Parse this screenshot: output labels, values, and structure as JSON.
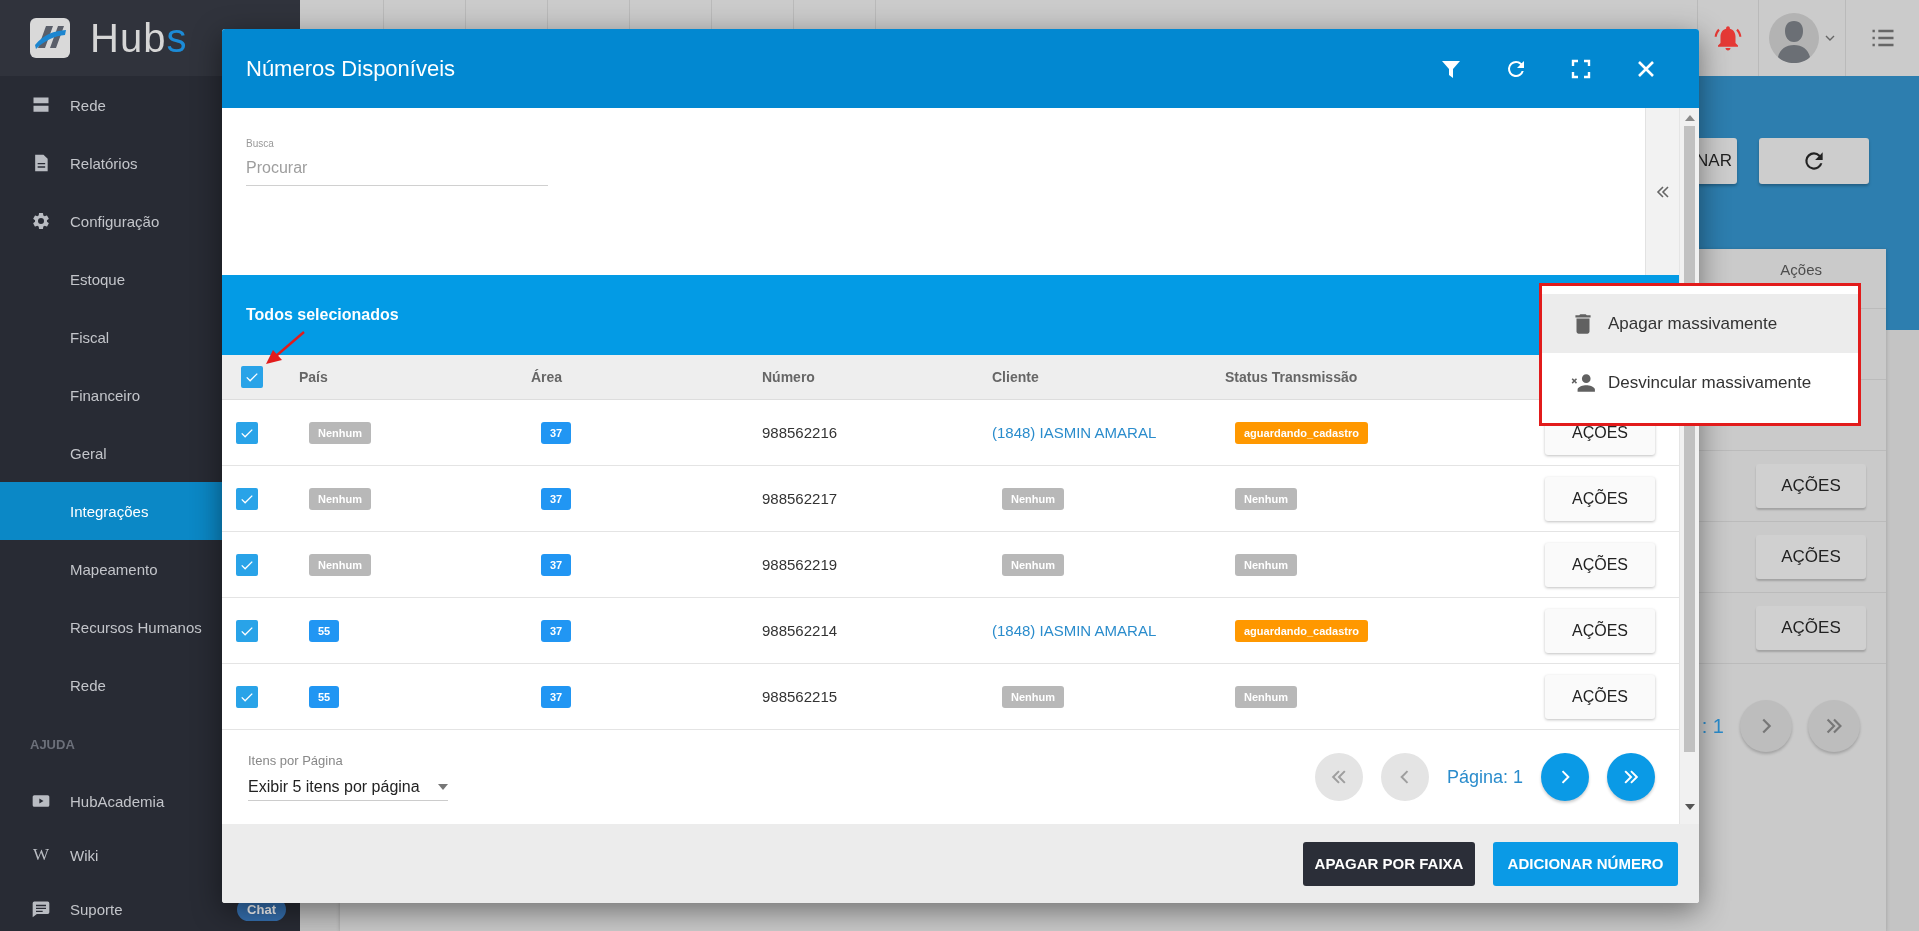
{
  "sidebar": {
    "logo": {
      "main": "Hub",
      "accent": "s"
    },
    "items": [
      {
        "label": "Rede",
        "kind": "server",
        "selected": false
      },
      {
        "label": "Relatórios",
        "kind": "document",
        "selected": false
      },
      {
        "label": "Configuração",
        "kind": "gear",
        "selected": false
      },
      {
        "label": "Estoque",
        "kind": "sub",
        "selected": false
      },
      {
        "label": "Fiscal",
        "kind": "sub",
        "selected": false
      },
      {
        "label": "Financeiro",
        "kind": "sub",
        "selected": false
      },
      {
        "label": "Geral",
        "kind": "sub",
        "selected": false
      },
      {
        "label": "Integrações",
        "kind": "sub",
        "selected": true
      },
      {
        "label": "Mapeamento",
        "kind": "sub",
        "selected": false
      },
      {
        "label": "Recursos Humanos",
        "kind": "sub",
        "selected": false
      },
      {
        "label": "Rede",
        "kind": "sub",
        "selected": false
      }
    ],
    "section": "AJUDA",
    "help_items": [
      {
        "label": "HubAcademia",
        "kind": "video",
        "selected": false
      },
      {
        "label": "Wiki",
        "kind": "glyph",
        "glyph": "W",
        "selected": false
      },
      {
        "label": "Suporte",
        "kind": "chat",
        "badge": "Chat",
        "selected": false
      }
    ]
  },
  "background": {
    "buttons": [
      {
        "kind": "text",
        "label": "NAR"
      },
      {
        "kind": "refresh"
      }
    ],
    "card": {
      "header": "Ações",
      "actions": [
        "AÇÕES",
        "AÇÕES",
        "AÇÕES"
      ],
      "page_text": ": 1"
    }
  },
  "modal": {
    "title": "Números Disponíveis",
    "search": {
      "label": "Busca",
      "placeholder": "Procurar"
    },
    "selection_banner": "Todos selecionados",
    "table": {
      "all_checked": true,
      "columns": [
        "País",
        "Área",
        "Número",
        "Cliente",
        "Status Transmissão"
      ],
      "rows": [
        {
          "checked": true,
          "cells": [
            {
              "kind": "empty",
              "text": "Nenhum"
            },
            {
              "kind": "code",
              "text": "37"
            },
            {
              "kind": "text",
              "text": "988562216"
            },
            {
              "kind": "link",
              "text": "(1848) IASMIN AMARAL"
            },
            {
              "kind": "status",
              "text": "aguardando_cadastro"
            }
          ],
          "action": "AÇÕES"
        },
        {
          "checked": true,
          "cells": [
            {
              "kind": "empty",
              "text": "Nenhum"
            },
            {
              "kind": "code",
              "text": "37"
            },
            {
              "kind": "text",
              "text": "988562217"
            },
            {
              "kind": "empty",
              "text": "Nenhum"
            },
            {
              "kind": "empty",
              "text": "Nenhum"
            }
          ],
          "action": "AÇÕES"
        },
        {
          "checked": true,
          "cells": [
            {
              "kind": "empty",
              "text": "Nenhum"
            },
            {
              "kind": "code",
              "text": "37"
            },
            {
              "kind": "text",
              "text": "988562219"
            },
            {
              "kind": "empty",
              "text": "Nenhum"
            },
            {
              "kind": "empty",
              "text": "Nenhum"
            }
          ],
          "action": "AÇÕES"
        },
        {
          "checked": true,
          "cells": [
            {
              "kind": "code",
              "text": "55"
            },
            {
              "kind": "code",
              "text": "37"
            },
            {
              "kind": "text",
              "text": "988562214"
            },
            {
              "kind": "link",
              "text": "(1848) IASMIN AMARAL"
            },
            {
              "kind": "status",
              "text": "aguardando_cadastro"
            }
          ],
          "action": "AÇÕES"
        },
        {
          "checked": true,
          "cells": [
            {
              "kind": "code",
              "text": "55"
            },
            {
              "kind": "code",
              "text": "37"
            },
            {
              "kind": "text",
              "text": "988562215"
            },
            {
              "kind": "empty",
              "text": "Nenhum"
            },
            {
              "kind": "empty",
              "text": "Nenhum"
            }
          ],
          "action": "AÇÕES"
        }
      ]
    },
    "pagination": {
      "label": "Itens por Página",
      "page_size": "Exibir 5 itens por página",
      "page": "Página: 1",
      "buttons": [
        {
          "kind": "first",
          "disabled": true
        },
        {
          "kind": "prev",
          "disabled": true
        },
        {
          "kind": "next",
          "disabled": false
        },
        {
          "kind": "last",
          "disabled": false
        }
      ]
    },
    "footer_buttons": [
      {
        "kind": "dark",
        "label": "APAGAR POR FAIXA"
      },
      {
        "kind": "primary",
        "label": "ADICIONAR NÚMERO"
      }
    ]
  },
  "menu": {
    "items": [
      {
        "kind": "trash",
        "label": "Apagar massivamente",
        "selected": true
      },
      {
        "kind": "unlink",
        "label": "Desvincular massivamente",
        "selected": false
      }
    ]
  }
}
